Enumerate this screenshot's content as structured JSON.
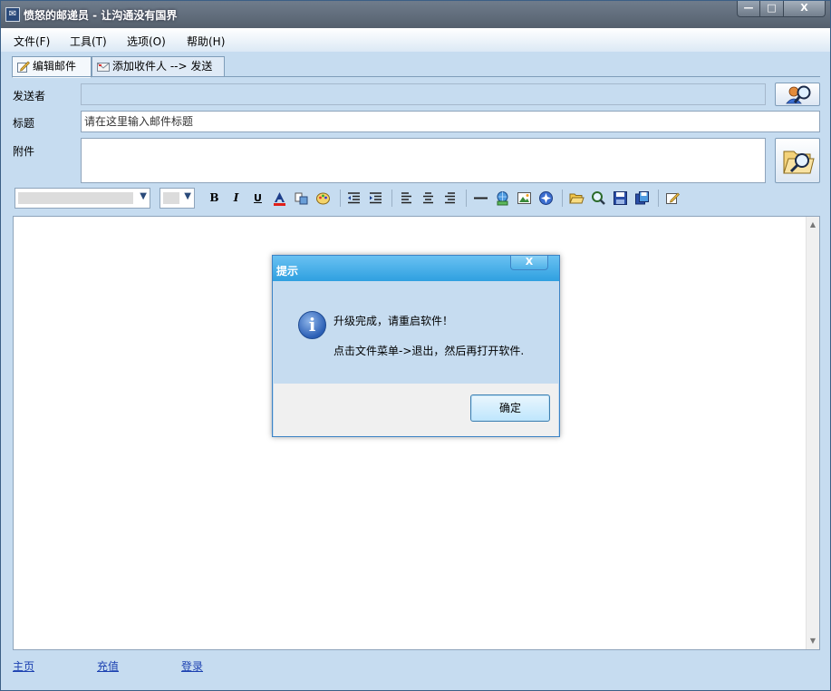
{
  "window": {
    "title": "愤怒的邮递员 - 让沟通没有国界",
    "buttons": {
      "minimize": "—",
      "maximize": "□",
      "close": "X"
    }
  },
  "menu": [
    {
      "label": "文件(F)"
    },
    {
      "label": "工具(T)"
    },
    {
      "label": "选项(O)"
    },
    {
      "label": "帮助(H)"
    }
  ],
  "tabs": [
    {
      "label": "编辑邮件",
      "icon": "edit-mail-icon",
      "active": true
    },
    {
      "label": "添加收件人 --> 发送",
      "icon": "envelope-icon",
      "active": false
    }
  ],
  "form": {
    "sender_label": "发送者",
    "sender_value": "",
    "subject_label": "标题",
    "subject_value": "请在这里输入邮件标题",
    "attachment_label": "附件",
    "attachment_value": ""
  },
  "toolbar": {
    "font_family": "",
    "font_size": "",
    "bold": "B",
    "italic": "I",
    "underline": "U"
  },
  "footer": {
    "home": "主页",
    "recharge": "充值",
    "login": "登录"
  },
  "dialog": {
    "title": "提示",
    "close": "X",
    "message_line1": "升级完成，请重启软件！",
    "message_line2": "点击文件菜单->退出，然后再打开软件.",
    "ok": "确定"
  },
  "colors": {
    "window_bg": "#c6dcf0",
    "dialog_title": "#2fa0e0",
    "link": "#1a3fb0"
  }
}
